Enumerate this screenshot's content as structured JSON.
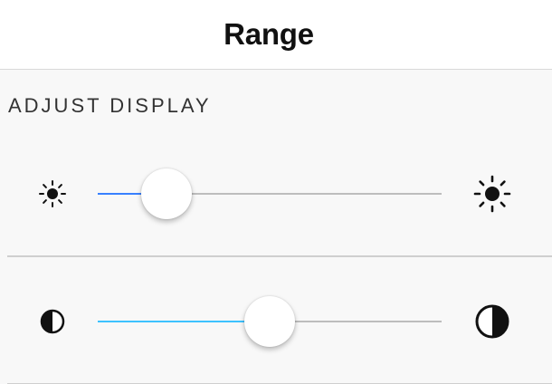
{
  "toolbar": {
    "title": "Range"
  },
  "section": {
    "header": "ADJUST DISPLAY"
  },
  "ranges": [
    {
      "name": "brightness",
      "start_icon": "sun-small-icon",
      "end_icon": "sun-large-icon",
      "value_fraction": 0.2,
      "fill_color": "#3880ff"
    },
    {
      "name": "contrast",
      "start_icon": "contrast-small-icon",
      "end_icon": "contrast-large-icon",
      "value_fraction": 0.5,
      "fill_color": "#3dc2ff"
    }
  ],
  "colors": {
    "track": "#bdbdbd",
    "background": "#f8f8f8"
  }
}
